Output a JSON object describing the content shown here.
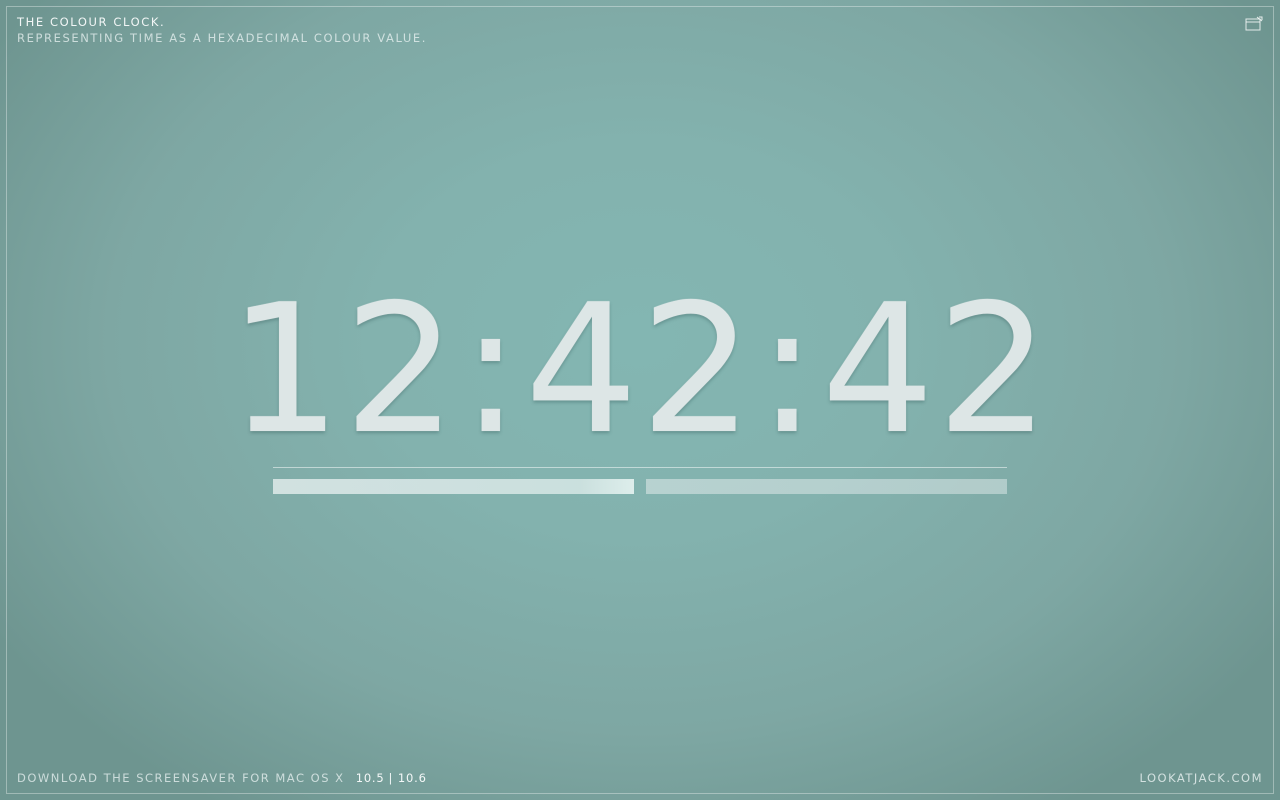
{
  "header": {
    "title": "The Colour Clock.",
    "subtitle": "Representing time as a hexadecimal colour value."
  },
  "fullscreen_icon": "fullscreen-toggle-icon",
  "clock": {
    "hours": "12",
    "minutes": "42",
    "seconds": "42",
    "separator": ":"
  },
  "progress": {
    "left_fraction": 1.0,
    "right_fraction": 1.0
  },
  "footer": {
    "download_text": "Download the screensaver for Mac OS X",
    "version_a": "10.5",
    "version_sep": "|",
    "version_b": "10.6",
    "site_link": "lookatjack.com"
  },
  "colors": {
    "background_center": "#83b6b2",
    "background_edge": "#6e9590",
    "digits": "#dde6e6"
  }
}
